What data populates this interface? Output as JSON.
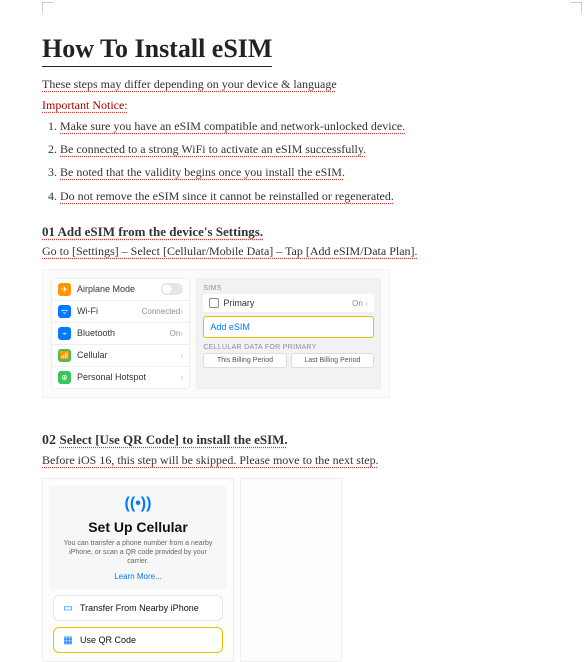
{
  "title": "How To Install eSIM",
  "subtitle": "These steps may differ depending on your device & language",
  "notice": "Important Notice:",
  "important": [
    "Make sure you have an eSIM compatible and network-unlocked device.",
    "Be connected to a strong WiFi to activate an eSIM successfully.",
    "Be noted that the validity begins once you install the eSIM.",
    "Do not remove the eSIM since it cannot be reinstalled or regenerated."
  ],
  "step1": {
    "heading": "01 Add eSIM from the device's Settings.",
    "hint": "Go to [Settings] – Select [Cellular/Mobile Data] – Tap [Add eSIM/Data Plan].",
    "left": {
      "airplane": "Airplane Mode",
      "wifi": "Wi-Fi",
      "wifi_status": "Connected",
      "bt": "Bluetooth",
      "bt_status": "On",
      "cell": "Cellular",
      "hotspot": "Personal Hotspot"
    },
    "right": {
      "sims": "SIMs",
      "primary": "Primary",
      "primary_status": "On",
      "add": "Add eSIM",
      "cdp": "CELLULAR DATA FOR PRIMARY",
      "seg1": "This Billing Period",
      "seg2": "Last Billing Period"
    }
  },
  "step2": {
    "num": "02",
    "heading": "Select [Use QR Code] to install the eSIM.",
    "hint": "Before iOS 16, this step will be skipped. Please move to the next step.",
    "card": {
      "title": "Set Up Cellular",
      "body": "You can transfer a phone number from a nearby iPhone, or scan a QR code provided by your carrier.",
      "learn": "Learn More...",
      "opt1": "Transfer From Nearby iPhone",
      "opt2": "Use QR Code"
    }
  }
}
